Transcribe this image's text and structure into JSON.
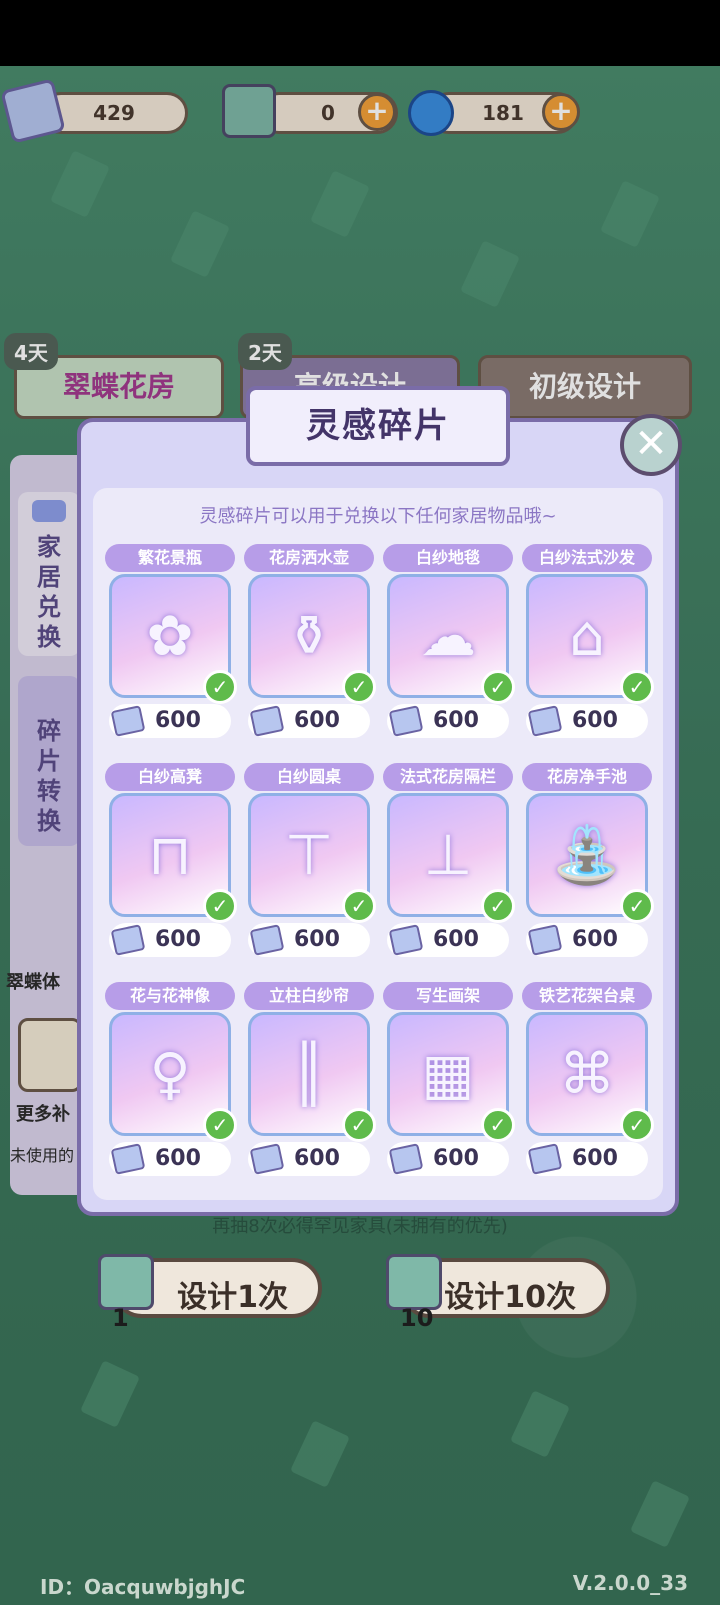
{
  "currency": {
    "fragments": "429",
    "tickets": "0",
    "swirl": "181"
  },
  "bg_tabs": {
    "tab1": "翠蝶花房",
    "tab1_days": "4天",
    "tab2": "高级设计",
    "tab2_days": "2天",
    "tab3": "初级设计"
  },
  "side_tabs": {
    "home_exchange": "家居兑换",
    "fragment_convert": "碎片转换"
  },
  "modal": {
    "title": "灵感碎片",
    "hint": "灵感碎片可以用于兑换以下任何家居物品哦~",
    "items": [
      {
        "name": "繁花景瓶",
        "price": "600"
      },
      {
        "name": "花房洒水壶",
        "price": "600"
      },
      {
        "name": "白纱地毯",
        "price": "600"
      },
      {
        "name": "白纱法式沙发",
        "price": "600"
      },
      {
        "name": "白纱高凳",
        "price": "600"
      },
      {
        "name": "白纱圆桌",
        "price": "600"
      },
      {
        "name": "法式花房隔栏",
        "price": "600"
      },
      {
        "name": "花房净手池",
        "price": "600"
      },
      {
        "name": "花与花神像",
        "price": "600"
      },
      {
        "name": "立柱白纱帘",
        "price": "600"
      },
      {
        "name": "写生画架",
        "price": "600"
      },
      {
        "name": "铁艺花架台桌",
        "price": "600"
      }
    ]
  },
  "bottom": {
    "note": "再抽8次必得罕见家具(未拥有的优先)",
    "draw1_label": "设计1次",
    "draw1_count": "1",
    "draw10_label": "设计10次",
    "draw10_count": "10",
    "side_caption1": "翠蝶体",
    "side_caption2": "更多补",
    "side_caption3": "未使用的"
  },
  "footer": {
    "id": "ID：OacquwbjghJC",
    "version": "V.2.0.0_33"
  }
}
